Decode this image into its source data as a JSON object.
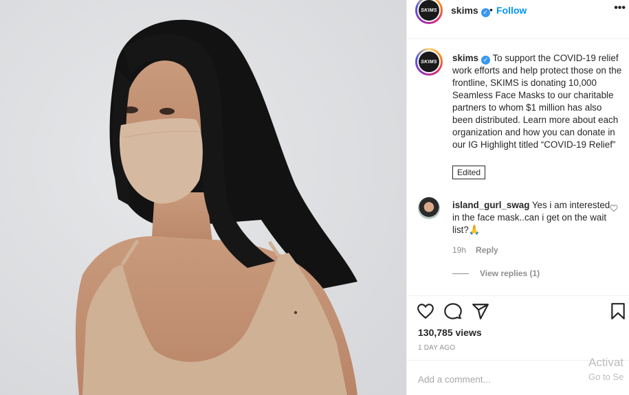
{
  "post": {
    "username": "skims",
    "avatar_text": "SKIMS",
    "follow_label": "Follow",
    "dot": "•",
    "more": "•••"
  },
  "caption": {
    "username": "skims",
    "text": "To support the COVID-19 relief work efforts and help protect those on the frontline, SKIMS is donating 10,000 Seamless Face Masks to our charitable partners to whom $1 million has also been distributed. Learn more about each organization and how you can donate in our IG Highlight titled “COVID-19 Relief”",
    "edited_label": "Edited"
  },
  "comment": {
    "username": "island_gurl_swag",
    "text": "Yes i am interested in the face mask..can i get on the wait list?🙏",
    "time": "19h",
    "reply_label": "Reply",
    "view_replies": "View replies (1)"
  },
  "stats": {
    "views": "130,785 views",
    "date": "1 DAY AGO"
  },
  "composer": {
    "placeholder": "Add a comment..."
  },
  "watermark": {
    "line1": "Activat",
    "line2": "Go to Se"
  },
  "icons": [
    "heart-icon",
    "comment-icon",
    "share-icon",
    "bookmark-icon",
    "verified-icon",
    "more-icon"
  ],
  "colors": {
    "accent": "#0095f6",
    "verified": "#3897f0",
    "muted": "#8e8e8e"
  }
}
